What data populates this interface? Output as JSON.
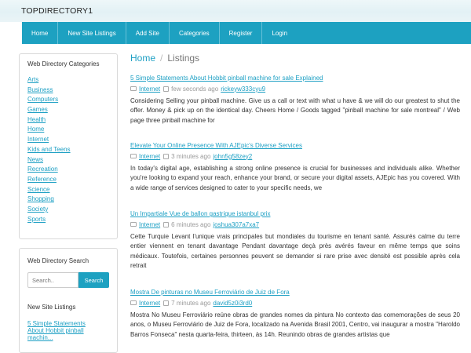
{
  "header": {
    "title": "TOPDIRECTORY1"
  },
  "nav": [
    {
      "label": "Home"
    },
    {
      "label": "New Site Listings"
    },
    {
      "label": "Add Site"
    },
    {
      "label": "Categories"
    },
    {
      "label": "Register"
    },
    {
      "label": "Login"
    }
  ],
  "sidebar": {
    "categories_title": "Web Directory Categories",
    "categories": [
      "Arts",
      "Business",
      "Computers",
      "Games",
      "Health",
      "Home",
      "Internet",
      "Kids and Teens",
      "News",
      "Recreation",
      "Reference",
      "Science",
      "Shopping",
      "Society",
      "Sports"
    ],
    "search_title": "Web Directory Search",
    "search_placeholder": "Search..",
    "search_button": "Search",
    "new_listings_title": "New Site Listings",
    "new_listings": [
      {
        "label": "5 Simple Statements About Hobbit pinball machin..."
      }
    ]
  },
  "breadcrumb": {
    "home": "Home",
    "separator": "/",
    "current": "Listings"
  },
  "listings": [
    {
      "title": "5 Simple Statements About Hobbit pinball machine for sale Explained",
      "category": "Internet",
      "time": "few seconds ago",
      "user": "rickeyw333cyu9",
      "body": "Considering Selling your pinball machine. Give us a call or text with what u have & we will do our greatest to shut the offer. Money & pick up on the identical day. Cheers Home / Goods tagged \"pinball machine for sale montreal\" / Web page three pinball machine for"
    },
    {
      "title": "Elevate Your Online Presence With AJEpic's Diverse Services",
      "category": "Internet",
      "time": "3 minutes ago",
      "user": "john5g58zey2",
      "body": "In today's digital age, establishing a strong online presence is crucial for businesses and individuals alike. Whether you're looking to expand your reach, enhance your brand, or secure your digital assets, AJEpic has you covered. With a wide range of services designed to cater to your specific needs, we"
    },
    {
      "title": "Un Impartiale Vue de ballon gastrique istanbul prix",
      "category": "Internet",
      "time": "6 minutes ago",
      "user": "joshua307a7xa7",
      "body": "Cette Turquie Levant l'unique vrais principales but mondiales du tourisme en tenant santé. Assurés calme du terre entier viennent en tenant davantage Pendant davantage deçà près avérés faveur en même temps que soins médicaux. Toutefois, certaines personnes peuvent se demander si rare prise avec densité est possible après cela retrait"
    },
    {
      "title": "Mostra De pinturas no Museu Ferroviário de Juiz de Fora",
      "category": "Internet",
      "time": "7 minutes ago",
      "user": "david5z0i3rd0",
      "body": "Mostra No Museu Ferroviário reúne obras de grandes nomes da pintura No contexto das comemorações de seus 20 anos, o Museu Ferroviário de Juiz de Fora, localizado na Avenida Brasil 2001, Centro, vai inaugurar a mostra \"Haroldo Barros Fonseca\" nesta quarta-feira, thirteen, às 14h. Reunindo obras de grandes artistas que"
    }
  ]
}
